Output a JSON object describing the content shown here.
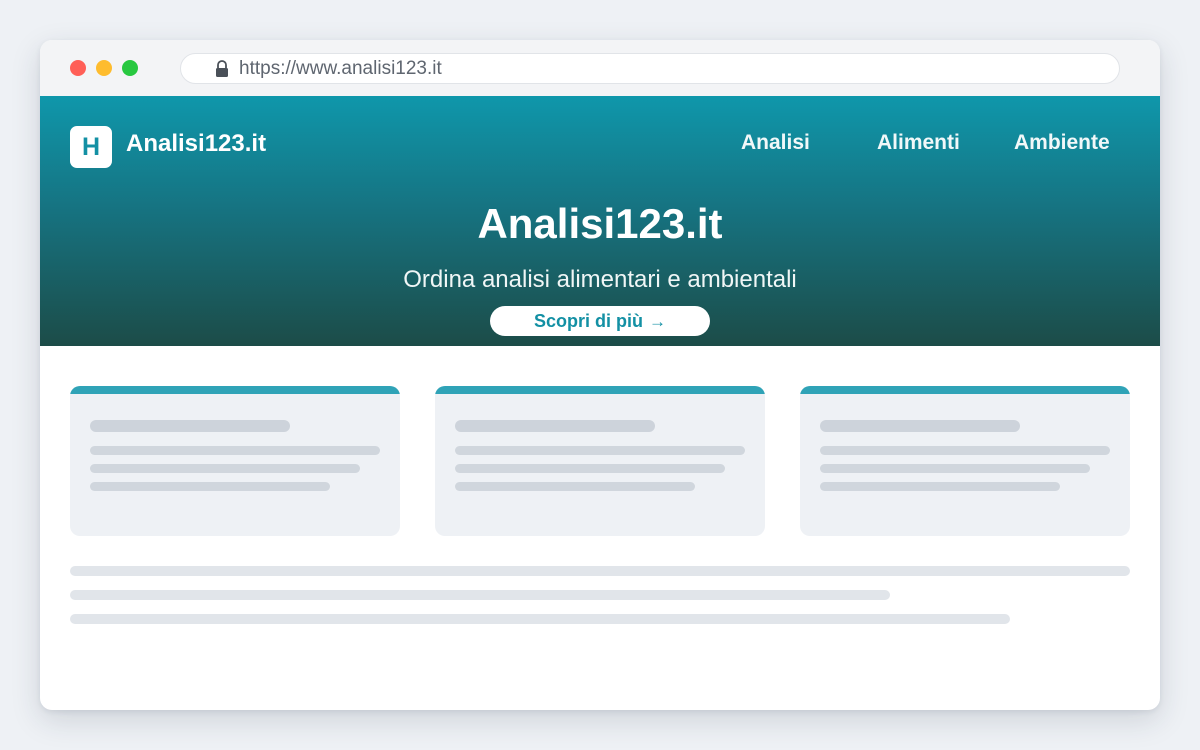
{
  "browser": {
    "url": "https://www.analisi123.it",
    "icons": [
      "lock-icon"
    ]
  },
  "header": {
    "logo_letter": "H",
    "brand_name": "Analisi123.it",
    "nav": [
      {
        "label": "Analisi"
      },
      {
        "label": "Alimenti"
      },
      {
        "label": "Ambiente"
      }
    ]
  },
  "hero": {
    "title": "Analisi123.it",
    "subtitle": "Ordina analisi alimentari e ambientali",
    "cta_label": "Scopri di più",
    "cta_arrow": "→"
  },
  "colors": {
    "accent": "#1390a4",
    "card_bar": "#2fa3b7",
    "hero_top": "#0f97ab",
    "hero_bottom": "#1c4c48"
  }
}
